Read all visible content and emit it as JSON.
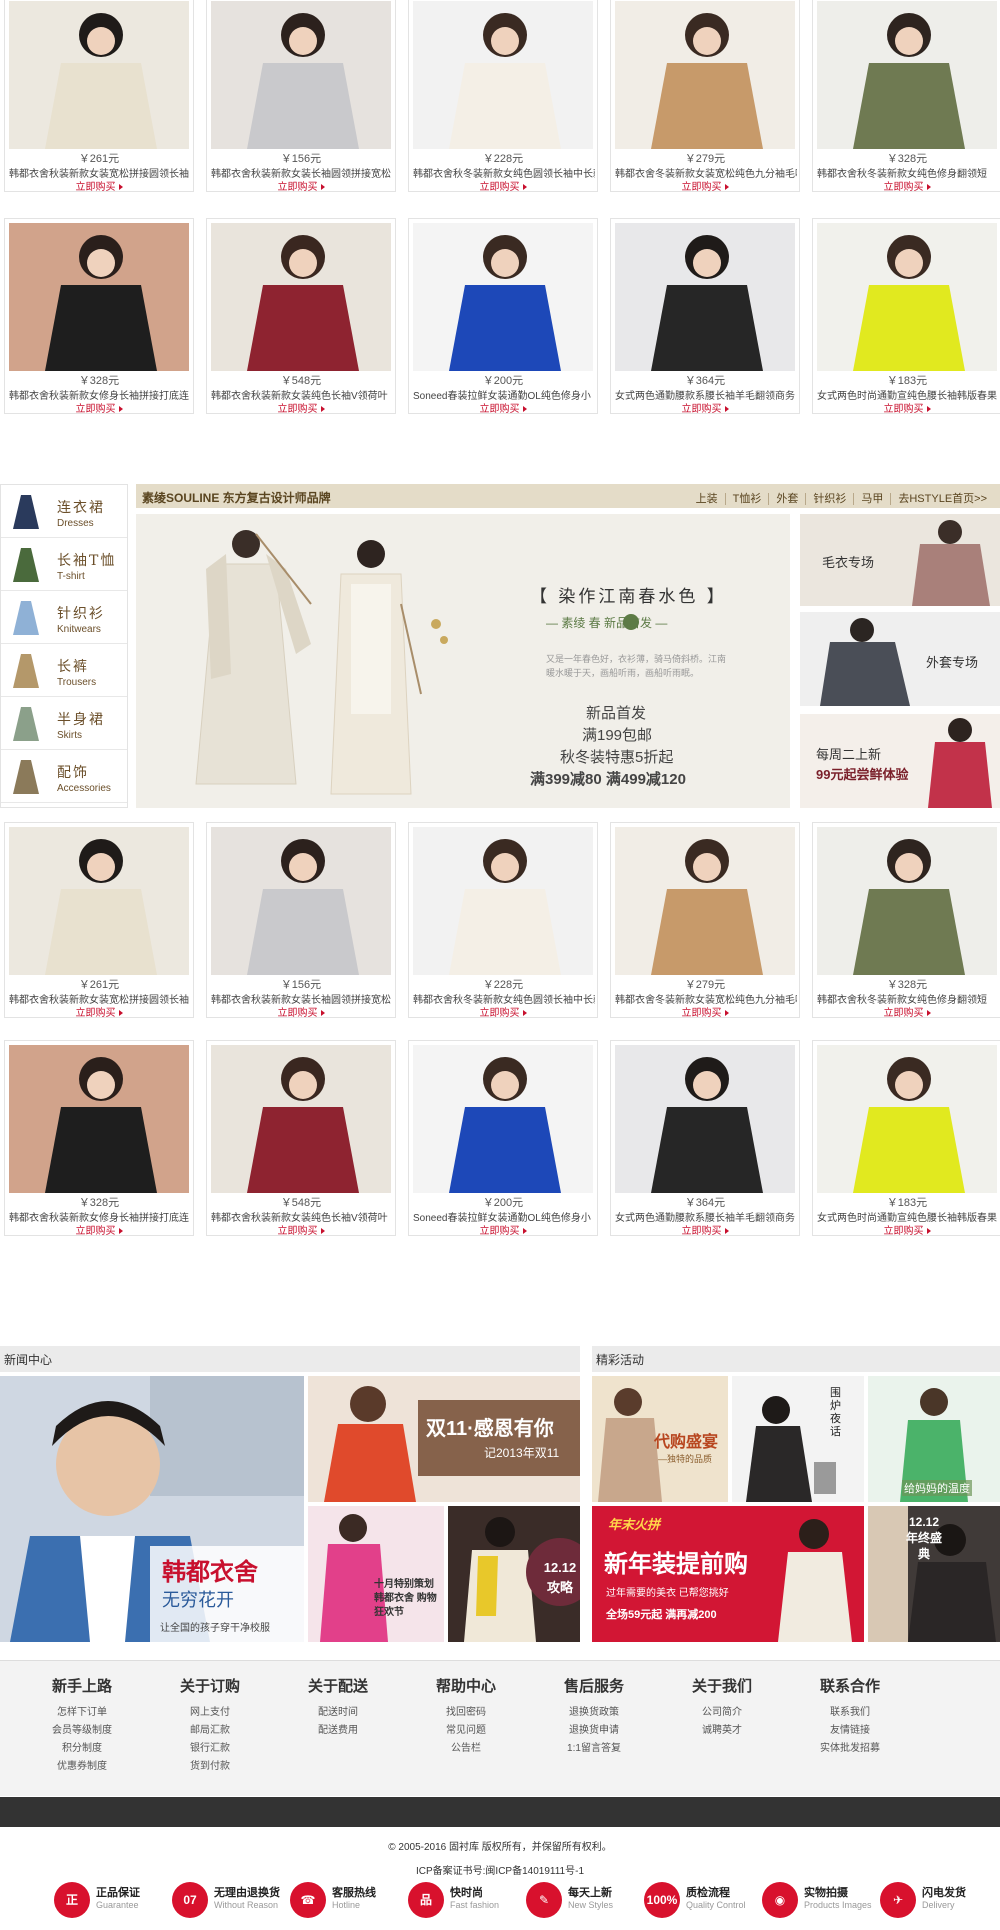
{
  "products_top": [
    {
      "price": "￥261元",
      "name": "韩都衣舍秋装新款女装宽松拼接圆领长袖",
      "buy": "立即购买"
    },
    {
      "price": "￥156元",
      "name": "韩都衣舍秋装新款女装长袖圆领拼接宽松",
      "buy": "立即购买"
    },
    {
      "price": "￥228元",
      "name": "韩都衣舍秋冬装新款女纯色圆领长袖中长款",
      "buy": "立即购买"
    },
    {
      "price": "￥279元",
      "name": "韩都衣舍冬装新款女装宽松纯色九分袖毛呢",
      "buy": "立即购买"
    },
    {
      "price": "￥328元",
      "name": "韩都衣舍秋冬装新款女纯色修身翻领短",
      "buy": "立即购买"
    },
    {
      "price": "￥328元",
      "name": "韩都衣舍秋装新款女修身长袖拼接打底连",
      "buy": "立即购买"
    },
    {
      "price": "￥548元",
      "name": "韩都衣舍秋装新款女装纯色长袖V领荷叶",
      "buy": "立即购买"
    },
    {
      "price": "￥200元",
      "name": "Soneed春装拉鲜女装通勤OL纯色修身小",
      "buy": "立即购买"
    },
    {
      "price": "￥364元",
      "name": "女式两色通勤腰款系腰长袖羊毛翻领商务",
      "buy": "立即购买"
    },
    {
      "price": "￥183元",
      "name": "女式两色时尚通勤宣纯色腰长袖韩版春果",
      "buy": "立即购买"
    }
  ],
  "products_bottom": [
    {
      "price": "￥261元",
      "name": "韩都衣舍秋装新款女装宽松拼接圆领长袖",
      "buy": "立即购买"
    },
    {
      "price": "￥156元",
      "name": "韩都衣舍秋装新款女装长袖圆领拼接宽松",
      "buy": "立即购买"
    },
    {
      "price": "￥228元",
      "name": "韩都衣舍秋冬装新款女纯色圆领长袖中长款",
      "buy": "立即购买"
    },
    {
      "price": "￥279元",
      "name": "韩都衣舍冬装新款女装宽松纯色九分袖毛呢",
      "buy": "立即购买"
    },
    {
      "price": "￥328元",
      "name": "韩都衣舍秋冬装新款女纯色修身翻领短",
      "buy": "立即购买"
    },
    {
      "price": "￥328元",
      "name": "韩都衣舍秋装新款女修身长袖拼接打底连",
      "buy": "立即购买"
    },
    {
      "price": "￥548元",
      "name": "韩都衣舍秋装新款女装纯色长袖V领荷叶",
      "buy": "立即购买"
    },
    {
      "price": "￥200元",
      "name": "Soneed春装拉鲜女装通勤OL纯色修身小",
      "buy": "立即购买"
    },
    {
      "price": "￥364元",
      "name": "女式两色通勤腰款系腰长袖羊毛翻领商务",
      "buy": "立即购买"
    },
    {
      "price": "￥183元",
      "name": "女式两色时尚通勤宣纯色腰长袖韩版春果",
      "buy": "立即购买"
    }
  ],
  "categories": [
    {
      "zh": "连衣裙",
      "en": "Dresses",
      "icon": "dress-icon"
    },
    {
      "zh": "长袖T恤",
      "en": "T-shirt",
      "icon": "tshirt-icon"
    },
    {
      "zh": "针织衫",
      "en": "Knitwears",
      "icon": "sweater-icon"
    },
    {
      "zh": "长裤",
      "en": "Trousers",
      "icon": "trousers-icon"
    },
    {
      "zh": "半身裙",
      "en": "Skirts",
      "icon": "skirt-icon"
    },
    {
      "zh": "配饰",
      "en": "Accessories",
      "icon": "shoe-icon"
    }
  ],
  "brand": {
    "title": "素绫SOULINE 东方复古设计师品牌",
    "links": [
      "上装",
      "T恤衫",
      "外套",
      "针织衫",
      "马甲",
      "去HSTYLE首页>>"
    ]
  },
  "banner": {
    "title": "【 染作江南春水色 】",
    "subtitle": "— 素绫 春 新品首发 —",
    "tiny": "又是一年春色好，衣衫薄，骑马倚斜桥。江南暖水暖于天，画船听雨，画船听雨眠。",
    "line1": "新品首发",
    "line2": "满199包邮",
    "line3": "秋冬装特惠5折起",
    "line4": "满399减80  满499减120"
  },
  "side_tiles": [
    {
      "label": "毛衣专场"
    },
    {
      "label": "外套专场"
    },
    {
      "label": "每周二上新",
      "label2": "99元起尝鲜体验"
    }
  ],
  "news": {
    "heading": "新闻中心",
    "big_title": "韩都衣舍",
    "big_sub": "无穷花开",
    "big_caption": "让全国的孩子穿干净校服",
    "t1_title": "双11·感恩有你",
    "t1_sub": "记2013年双11",
    "t2_text": "十月特别策划 韩都衣舍 购物狂欢节",
    "t3_text": "12.12 攻略"
  },
  "events": {
    "heading": "精彩活动",
    "e1": "代购盛宴",
    "e1_sub": "—独特的品质",
    "e2": "围炉夜话",
    "e3": "给妈妈的温度",
    "e4_tag": "年末火拼",
    "e4_title": "新年装提前购",
    "e4_sub": "过年需要的美衣 已帮您挑好",
    "e4_price": "全场59元起  满再减200",
    "e5": "12.12 年终盛典"
  },
  "footer_cols": [
    {
      "title": "新手上路",
      "items": [
        "怎样下订单",
        "会员等级制度",
        "积分制度",
        "优惠券制度"
      ]
    },
    {
      "title": "关于订购",
      "items": [
        "网上支付",
        "邮局汇款",
        "银行汇款",
        "货到付款"
      ]
    },
    {
      "title": "关于配送",
      "items": [
        "配送时间",
        "配送费用"
      ]
    },
    {
      "title": "帮助中心",
      "items": [
        "找回密码",
        "常见问题",
        "公告栏"
      ]
    },
    {
      "title": "售后服务",
      "items": [
        "退换货政策",
        "退换货申请",
        "1:1留言答复"
      ]
    },
    {
      "title": "关于我们",
      "items": [
        "公司简介",
        "诚聘英才"
      ]
    },
    {
      "title": "联系合作",
      "items": [
        "联系我们",
        "友情链接",
        "实体批发招募"
      ]
    }
  ],
  "copyright": "© 2005-2016 固衬库 版权所有，并保留所有权利。",
  "icp": "ICP备案证书号:闽ICP备14019111号-1",
  "badges": [
    {
      "glyph": "正",
      "zh": "正品保证",
      "en": "Guarantee"
    },
    {
      "glyph": "07",
      "zh": "无理由退换货",
      "en": "Without Reason"
    },
    {
      "glyph": "☎",
      "zh": "客服热线",
      "en": "Hotline"
    },
    {
      "glyph": "品",
      "zh": "快时尚",
      "en": "Fast fashion"
    },
    {
      "glyph": "✎",
      "zh": "每天上新",
      "en": "New Styles"
    },
    {
      "glyph": "100%",
      "zh": "质检流程",
      "en": "Quality Control"
    },
    {
      "glyph": "◉",
      "zh": "实物拍摄",
      "en": "Products Images"
    },
    {
      "glyph": "✈",
      "zh": "闪电发货",
      "en": "Delivery"
    }
  ],
  "colors": {
    "accent": "#c8102e",
    "brand_bar": "#e4dcc8",
    "footer_dark": "#333333"
  }
}
